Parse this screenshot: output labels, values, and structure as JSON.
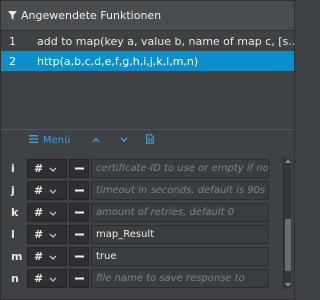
{
  "panel": {
    "title": "Angewendete Funktionen",
    "icon": "filter-icon"
  },
  "functions": [
    {
      "num": "1",
      "text": "add to map(key a, value b, name of map c, [s...",
      "selected": false
    },
    {
      "num": "2",
      "text": "http(a,b,c,d,e,f,g,h,i,j,k,l,m,n)",
      "selected": true
    }
  ],
  "toolbar": {
    "menu_label": "Menü",
    "menu_icon": "hamburger-icon",
    "up_icon": "chevron-up-icon",
    "down_icon": "chevron-down-icon",
    "doc_icon": "document-icon"
  },
  "params": [
    {
      "letter": "i",
      "type": "#",
      "value": "",
      "placeholder": "certificate-ID to use or empty if no"
    },
    {
      "letter": "j",
      "type": "#",
      "value": "",
      "placeholder": "timeout in seconds, default is 90s"
    },
    {
      "letter": "k",
      "type": "#",
      "value": "",
      "placeholder": "amount of retries, default 0"
    },
    {
      "letter": "l",
      "type": "#",
      "value": "map_Result",
      "placeholder": ""
    },
    {
      "letter": "m",
      "type": "#",
      "value": "true",
      "placeholder": ""
    },
    {
      "letter": "n",
      "type": "#",
      "value": "",
      "placeholder": "file name to save response to"
    }
  ],
  "colors": {
    "accent": "#0b8fcf",
    "toolbar_blue": "#3aa0e0",
    "background": "#3f4245"
  }
}
